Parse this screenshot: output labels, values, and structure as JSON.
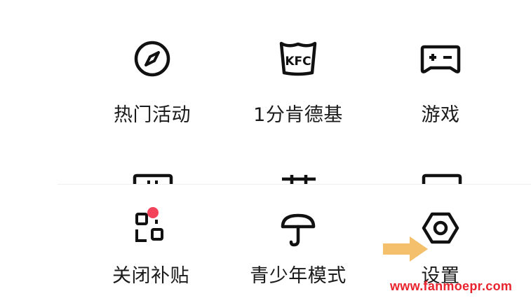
{
  "grid": {
    "row1": [
      {
        "label": "热门活动",
        "icon": "compass-icon"
      },
      {
        "label": "1分肯德基",
        "icon": "kfc-bucket-icon",
        "icon_text": "KFC"
      },
      {
        "label": "游戏",
        "icon": "gamepad-icon"
      }
    ]
  },
  "sheet": {
    "items": [
      {
        "label": "关闭补贴",
        "icon": "qr-grid-icon",
        "badge": true
      },
      {
        "label": "青少年模式",
        "icon": "umbrella-icon"
      },
      {
        "label": "设置",
        "icon": "hex-nut-settings-icon"
      }
    ]
  },
  "annotation": {
    "arrow_icon": "pointer-arrow-icon",
    "arrow_color": "#f4c06b",
    "watermark": "www.fanmoepr.com",
    "watermark_color": "#e8232e"
  },
  "colors": {
    "text": "#1a1a1a",
    "icon": "#111111",
    "badge": "#f2435a"
  }
}
